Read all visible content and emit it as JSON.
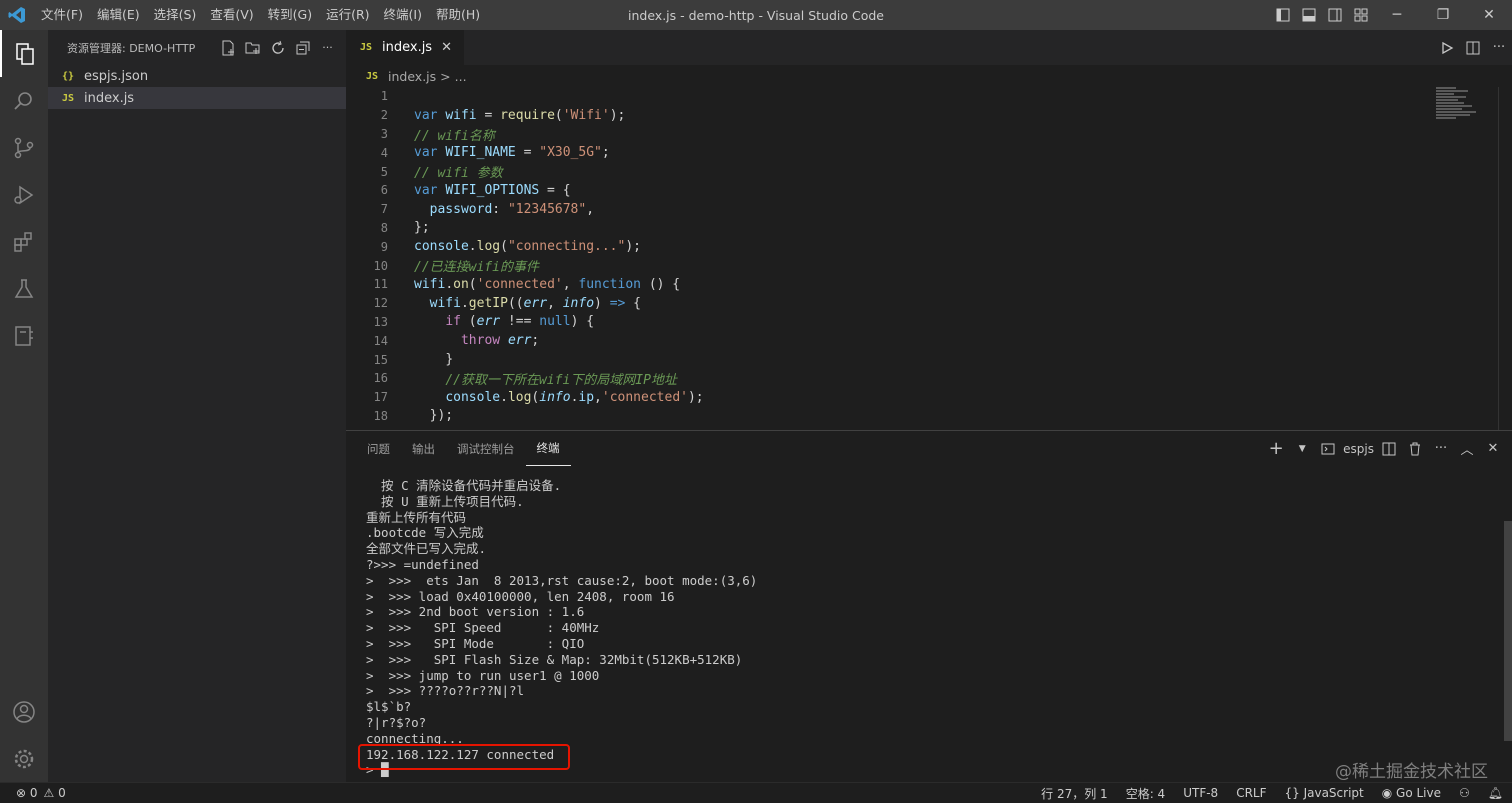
{
  "titlebar": {
    "logo": "VS",
    "menu": [
      "文件(F)",
      "编辑(E)",
      "选择(S)",
      "查看(V)",
      "转到(G)",
      "运行(R)",
      "终端(I)",
      "帮助(H)"
    ],
    "window_title": "index.js - demo-http - Visual Studio Code"
  },
  "sidebar": {
    "header": "资源管理器: DEMO-HTTP",
    "files": [
      {
        "icon": "{}",
        "name": "espjs.json"
      },
      {
        "icon": "JS",
        "name": "index.js"
      }
    ]
  },
  "editor": {
    "tab_icon": "JS",
    "tab_label": "index.js",
    "breadcrumb_icon": "JS",
    "breadcrumb_file": "index.js",
    "breadcrumb_sep": ">",
    "breadcrumb_more": "...",
    "line_numbers": [
      "1",
      "2",
      "3",
      "4",
      "5",
      "6",
      "7",
      "8",
      "9",
      "10",
      "11",
      "12",
      "13",
      "14",
      "15",
      "16",
      "17",
      "18"
    ],
    "lines": [
      {
        "indent": "",
        "parts": []
      },
      {
        "indent": "",
        "parts": [
          [
            "kw",
            "var "
          ],
          [
            "var",
            "wifi"
          ],
          [
            "pn",
            " = "
          ],
          [
            "fn",
            "require"
          ],
          [
            "pn",
            "("
          ],
          [
            "str",
            "'Wifi'"
          ],
          [
            "pn",
            ");"
          ]
        ]
      },
      {
        "indent": "",
        "parts": [
          [
            "cmt",
            "// wifi名称"
          ]
        ]
      },
      {
        "indent": "",
        "parts": [
          [
            "kw",
            "var "
          ],
          [
            "var",
            "WIFI_NAME"
          ],
          [
            "pn",
            " = "
          ],
          [
            "str",
            "\"X30_5G\""
          ],
          [
            "pn",
            ";"
          ]
        ]
      },
      {
        "indent": "",
        "parts": [
          [
            "cmt",
            "// wifi 参数"
          ]
        ]
      },
      {
        "indent": "",
        "parts": [
          [
            "kw",
            "var "
          ],
          [
            "var",
            "WIFI_OPTIONS"
          ],
          [
            "pn",
            " = {"
          ]
        ]
      },
      {
        "indent": "  ",
        "parts": [
          [
            "var",
            "password"
          ],
          [
            "pn",
            ": "
          ],
          [
            "str",
            "\"12345678\""
          ],
          [
            "pn",
            ","
          ]
        ]
      },
      {
        "indent": "",
        "parts": [
          [
            "pn",
            "};"
          ]
        ]
      },
      {
        "indent": "",
        "parts": [
          [
            "var",
            "console"
          ],
          [
            "pn",
            "."
          ],
          [
            "fn",
            "log"
          ],
          [
            "pn",
            "("
          ],
          [
            "str",
            "\"connecting...\""
          ],
          [
            "pn",
            ");"
          ]
        ]
      },
      {
        "indent": "",
        "parts": [
          [
            "cmt",
            "//已连接wifi的事件"
          ]
        ]
      },
      {
        "indent": "",
        "parts": [
          [
            "var",
            "wifi"
          ],
          [
            "pn",
            "."
          ],
          [
            "fn",
            "on"
          ],
          [
            "pn",
            "("
          ],
          [
            "str",
            "'connected'"
          ],
          [
            "pn",
            ", "
          ],
          [
            "kw",
            "function"
          ],
          [
            "pn",
            " () {"
          ]
        ]
      },
      {
        "indent": "  ",
        "parts": [
          [
            "var",
            "wifi"
          ],
          [
            "pn",
            "."
          ],
          [
            "fn",
            "getIP"
          ],
          [
            "pn",
            "(("
          ],
          [
            "prm",
            "err"
          ],
          [
            "pn",
            ", "
          ],
          [
            "prm",
            "info"
          ],
          [
            "pn",
            ") "
          ],
          [
            "kw",
            "=>"
          ],
          [
            "pn",
            " {"
          ]
        ]
      },
      {
        "indent": "    ",
        "parts": [
          [
            "ctl",
            "if"
          ],
          [
            "pn",
            " ("
          ],
          [
            "prm",
            "err"
          ],
          [
            "pn",
            " !== "
          ],
          [
            "kw",
            "null"
          ],
          [
            "pn",
            ") {"
          ]
        ]
      },
      {
        "indent": "      ",
        "parts": [
          [
            "ctl",
            "throw "
          ],
          [
            "prm",
            "err"
          ],
          [
            "pn",
            ";"
          ]
        ]
      },
      {
        "indent": "    ",
        "parts": [
          [
            "pn",
            "}"
          ]
        ]
      },
      {
        "indent": "    ",
        "parts": [
          [
            "cmt",
            "//获取一下所在wifi下的局域网IP地址"
          ]
        ]
      },
      {
        "indent": "    ",
        "parts": [
          [
            "var",
            "console"
          ],
          [
            "pn",
            "."
          ],
          [
            "fn",
            "log"
          ],
          [
            "pn",
            "("
          ],
          [
            "prm",
            "info"
          ],
          [
            "pn",
            "."
          ],
          [
            "var",
            "ip"
          ],
          [
            "pn",
            ","
          ],
          [
            "str",
            "'connected'"
          ],
          [
            "pn",
            ");"
          ]
        ]
      },
      {
        "indent": "  ",
        "parts": [
          [
            "pn",
            "});"
          ]
        ]
      }
    ]
  },
  "panel": {
    "tabs": [
      "问题",
      "输出",
      "调试控制台",
      "终端"
    ],
    "active_tab": "终端",
    "terminal_name": "espjs",
    "terminal_lines": [
      "  按 C 清除设备代码并重启设备.",
      "  按 U 重新上传项目代码.",
      "重新上传所有代码",
      ".bootcde 写入完成",
      "全部文件已写入完成.",
      "?>>> =undefined",
      ">  >>>  ets Jan  8 2013,rst cause:2, boot mode:(3,6)",
      ">  >>> load 0x40100000, len 2408, room 16",
      ">  >>> 2nd boot version : 1.6",
      ">  >>>   SPI Speed      : 40MHz",
      ">  >>>   SPI Mode       : QIO",
      ">  >>>   SPI Flash Size & Map: 32Mbit(512KB+512KB)",
      ">  >>> jump to run user1 @ 1000",
      ">  >>> ????o??r??N|?l",
      "$l$`b?",
      "?|r?$?o?",
      "connecting...",
      "192.168.122.127 connected",
      "> █"
    ],
    "watermark": "@稀土掘金技术社区"
  },
  "statusbar": {
    "errors": "⊗ 0",
    "warnings": "⚠ 0",
    "position": "行 27，列 1",
    "spaces": "空格: 4",
    "encoding": "UTF-8",
    "eol": "CRLF",
    "language": "{} JavaScript",
    "golive": "◉ Go Live",
    "accent_colors": {
      "highlight_border": "#e51400",
      "vscode_blue": "#3c99d4"
    }
  }
}
